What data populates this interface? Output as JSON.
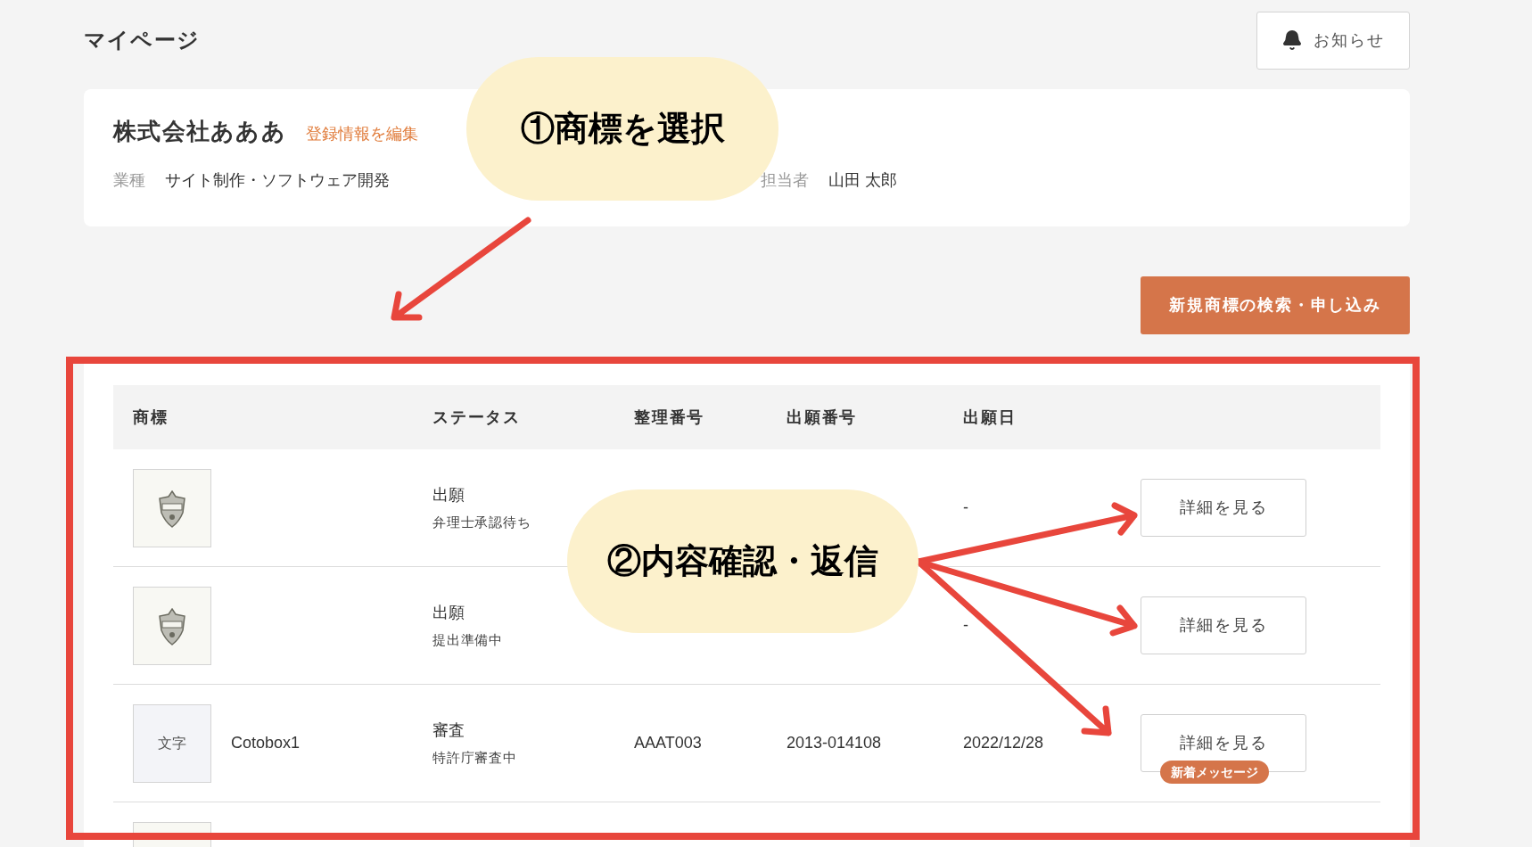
{
  "page": {
    "title": "マイページ",
    "notice_button": "お知らせ"
  },
  "company": {
    "name": "株式会社あああ",
    "edit_link": "登録情報を編集",
    "industry_label": "業種",
    "industry": "サイト制作・ソフトウェア開発",
    "contact_label": "担当者",
    "contact": "山田 太郎"
  },
  "new_button": "新規商標の検索・申し込み",
  "table": {
    "columns": [
      "商標",
      "ステータス",
      "整理番号",
      "出願番号",
      "出願日"
    ],
    "rows": [
      {
        "thumb": {
          "kind": "logo"
        },
        "status": "出願",
        "substatus": "弁理士承認待ち",
        "date": "-",
        "button": "詳細を見る"
      },
      {
        "thumb": {
          "kind": "logo"
        },
        "status": "出願",
        "substatus": "提出準備中",
        "date": "-",
        "button": "詳細を見る"
      },
      {
        "thumb": {
          "kind": "text",
          "text": "文字"
        },
        "name": "Cotobox1",
        "status": "審査",
        "substatus": "特許庁審査中",
        "ref_no": "AAAT003",
        "app_no": "2013-014108",
        "date": "2022/12/28",
        "button": "詳細を見る",
        "badge": "新着メッセージ"
      },
      {
        "thumb": {
          "kind": "cut"
        }
      }
    ]
  },
  "annotations": [
    {
      "text": "①商標を選択"
    },
    {
      "text": "②内容確認・返信"
    }
  ]
}
